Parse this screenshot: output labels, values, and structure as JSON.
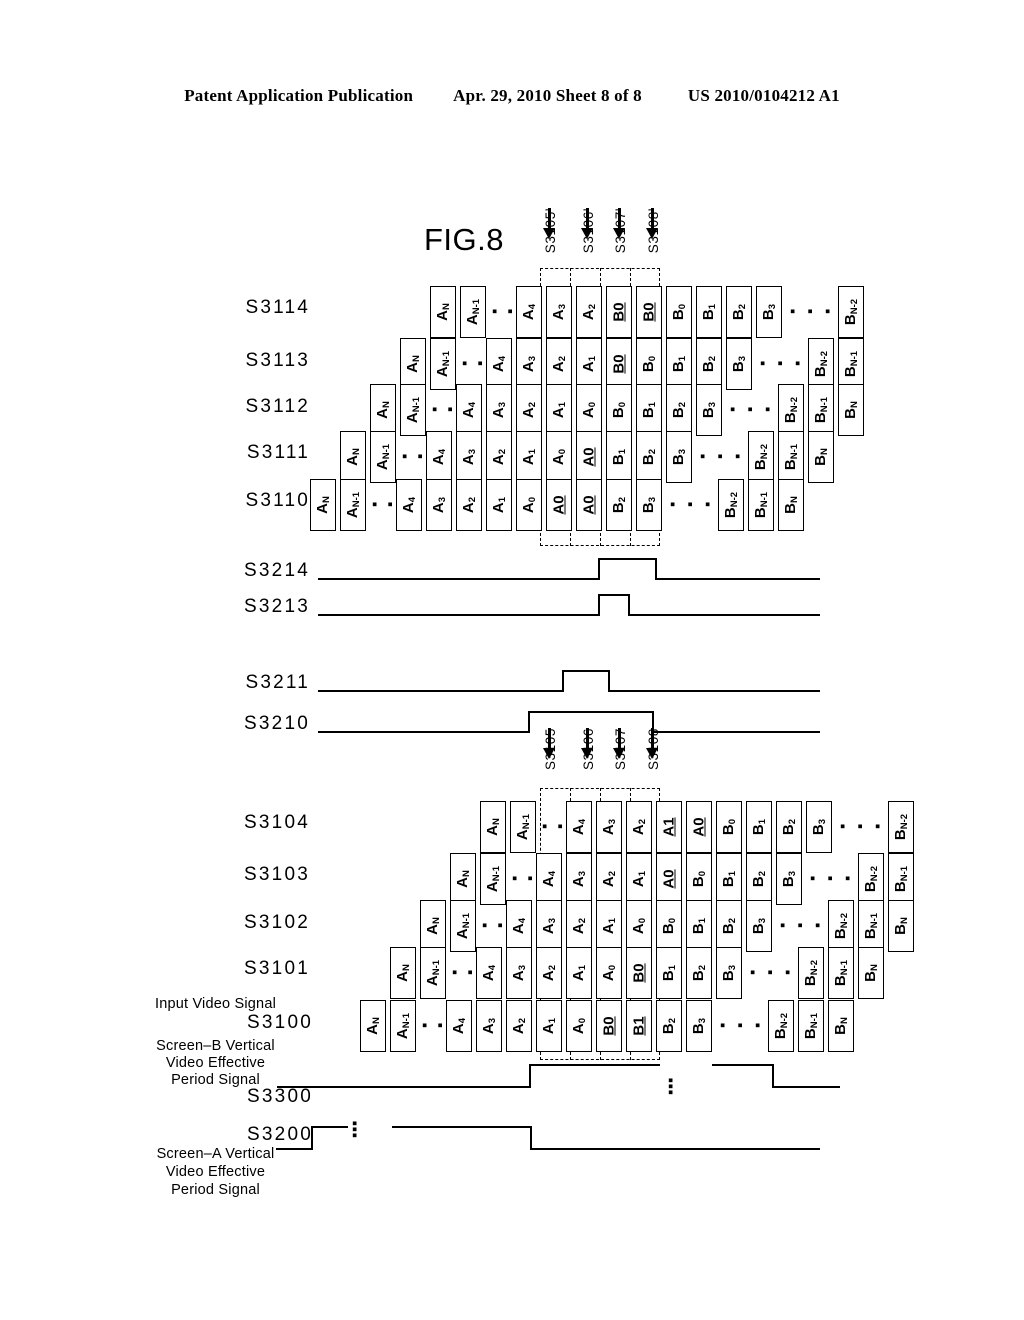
{
  "header": {
    "left": "Patent Application Publication",
    "middle": "Apr. 29, 2010  Sheet 8 of 8",
    "right": "US 2010/0104212 A1"
  },
  "figure": {
    "title": "FIG.8"
  },
  "markers_upper": [
    {
      "label": "S3105'"
    },
    {
      "label": "S3106'"
    },
    {
      "label": "S3107'"
    },
    {
      "label": "S3108'"
    }
  ],
  "markers_lower": [
    {
      "label": "S3105"
    },
    {
      "label": "S3106"
    },
    {
      "label": "S3107"
    },
    {
      "label": "S3108"
    }
  ],
  "cell_rows_upper": [
    {
      "name": "S3114",
      "left_cells": [
        "A_N",
        "A_N-1"
      ],
      "mid_cells": [
        "A_4",
        "A_3",
        "A_2",
        "B0",
        "B0",
        "B_0",
        "B_1",
        "B_2",
        "B_3"
      ],
      "right_cells": [
        "B_N-2"
      ]
    },
    {
      "name": "S3113",
      "left_cells": [
        "A_N",
        "A_N-1"
      ],
      "mid_cells": [
        "A_4",
        "A_3",
        "A_2",
        "A_1",
        "B0",
        "B_0",
        "B_1",
        "B_2",
        "B_3"
      ],
      "right_cells": [
        "B_N-2",
        "B_N-1"
      ]
    },
    {
      "name": "S3112",
      "left_cells": [
        "A_N",
        "A_N-1"
      ],
      "mid_cells": [
        "A_4",
        "A_3",
        "A_2",
        "A_1",
        "A_0",
        "B_0",
        "B_1",
        "B_2",
        "B_3"
      ],
      "right_cells": [
        "B_N-2",
        "B_N-1",
        "B_N"
      ]
    },
    {
      "name": "S3111",
      "left_cells": [
        "A_N",
        "A_N-1"
      ],
      "mid_cells": [
        "A_4",
        "A_3",
        "A_2",
        "A_1",
        "A_0",
        "A0",
        "B_1",
        "B_2",
        "B_3"
      ],
      "right_cells": [
        "B_N-2",
        "B_N-1",
        "B_N"
      ]
    },
    {
      "name": "S3110",
      "left_cells": [
        "A_N",
        "A_N-1"
      ],
      "mid_cells": [
        "A_4",
        "A_3",
        "A_2",
        "A_1",
        "A_0",
        "A0",
        "A0",
        "B_2",
        "B_3"
      ],
      "right_cells": [
        "B_N-2",
        "B_N-1",
        "B_N"
      ]
    }
  ],
  "cell_rows_lower": [
    {
      "name": "S3104",
      "left_cells": [
        "A_N",
        "A_N-1"
      ],
      "mid_cells": [
        "A_4",
        "A_3",
        "A_2",
        "A1",
        "A0",
        "B_0",
        "B_1",
        "B_2",
        "B_3"
      ],
      "right_cells": [
        "B_N-2"
      ]
    },
    {
      "name": "S3103",
      "left_cells": [
        "A_N",
        "A_N-1"
      ],
      "mid_cells": [
        "A_4",
        "A_3",
        "A_2",
        "A_1",
        "A0",
        "B_0",
        "B_1",
        "B_2",
        "B_3"
      ],
      "right_cells": [
        "B_N-2",
        "B_N-1"
      ]
    },
    {
      "name": "S3102",
      "left_cells": [
        "A_N",
        "A_N-1"
      ],
      "mid_cells": [
        "A_4",
        "A_3",
        "A_2",
        "A_1",
        "A_0",
        "B_0",
        "B_1",
        "B_2",
        "B_3"
      ],
      "right_cells": [
        "B_N-2",
        "B_N-1",
        "B_N"
      ]
    },
    {
      "name": "S3101",
      "left_cells": [
        "A_N",
        "A_N-1"
      ],
      "mid_cells": [
        "A_4",
        "A_3",
        "A_2",
        "A_1",
        "A_0",
        "B0",
        "B_1",
        "B_2",
        "B_3"
      ],
      "right_cells": [
        "B_N-2",
        "B_N-1",
        "B_N"
      ]
    },
    {
      "name": "S3100",
      "left_cells": [
        "A_N",
        "A_N-1"
      ],
      "mid_cells": [
        "A_4",
        "A_3",
        "A_2",
        "A_1",
        "A_0",
        "B0",
        "B1",
        "B_2",
        "B_3"
      ],
      "right_cells": [
        "B_N-2",
        "B_N-1",
        "B_N"
      ]
    }
  ],
  "waveforms": [
    {
      "name": "S3214",
      "kind": "pulse"
    },
    {
      "name": "S3213",
      "kind": "pulse"
    },
    {
      "name": "S3211",
      "kind": "pulse"
    },
    {
      "name": "S3210",
      "kind": "pulse"
    }
  ],
  "labels": {
    "input_video_signal": "Input Video Signal",
    "s3100": "S3100",
    "screen_b_line1": "Screen–B Vertical",
    "screen_b_line2": "Video Effective",
    "screen_b_line3": "Period Signal",
    "s3300": "S3300",
    "s3200": "S3200",
    "screen_a_line1": "Screen–A Vertical",
    "screen_a_line2": "Video Effective",
    "screen_a_line3": "Period Signal",
    "ellipsis": "▪ ▪ ▪"
  }
}
